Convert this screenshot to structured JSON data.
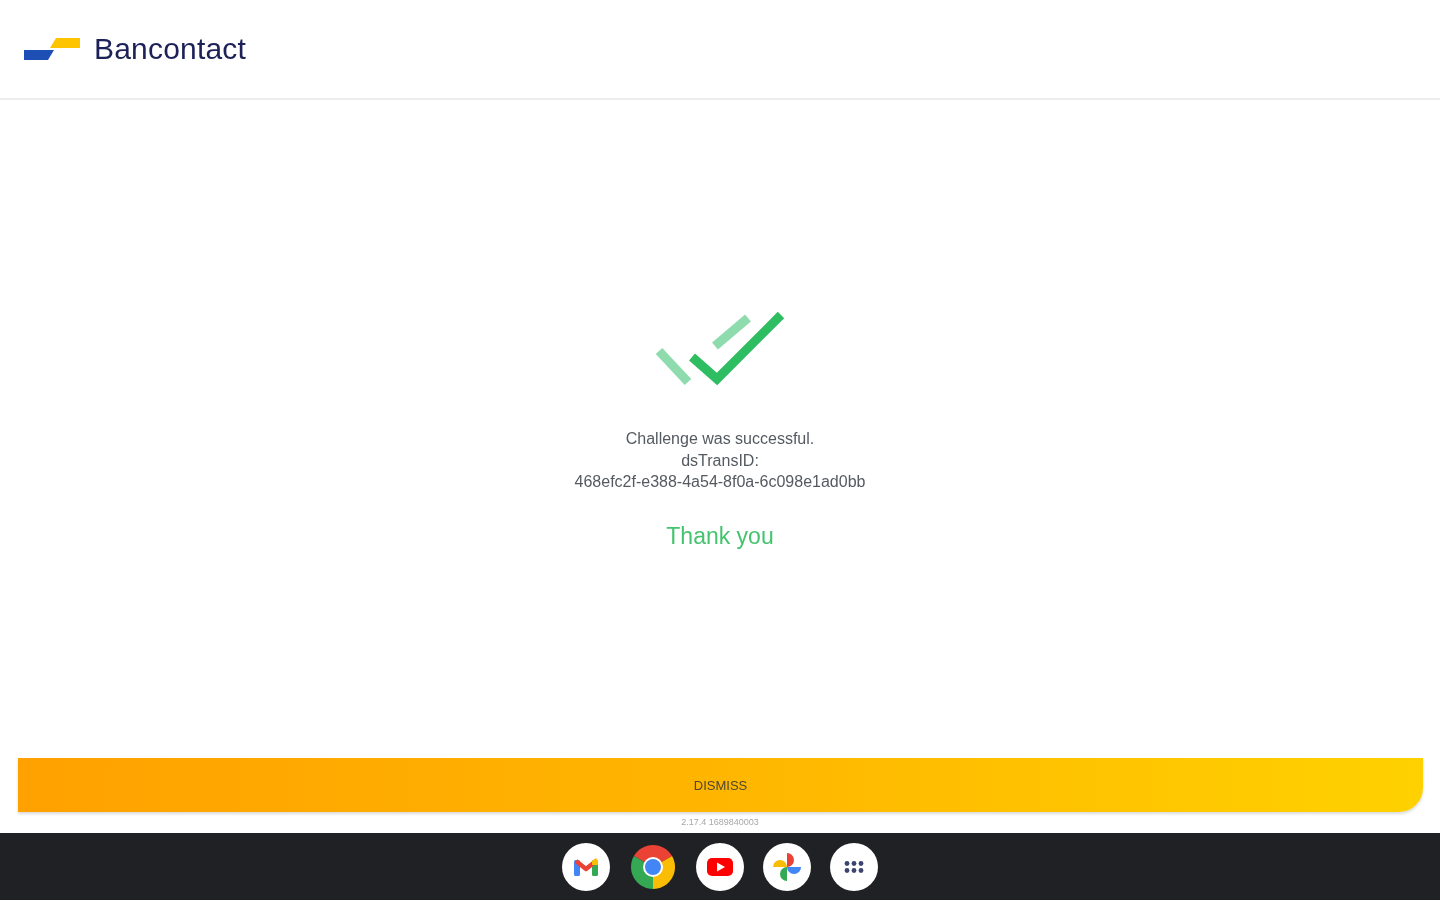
{
  "header": {
    "brand": "Bancontact"
  },
  "result": {
    "status": "Challenge was successful.",
    "id_label": "dsTransID:",
    "id_value": "468efc2f-e388-4a54-8f0a-6c098e1ad0bb",
    "thank_you": "Thank you"
  },
  "dismiss_button": {
    "label": "DISMISS"
  },
  "version": "2.17.4 1689840003",
  "shelf": {
    "apps": [
      {
        "kind": "mail"
      },
      {
        "kind": "browser"
      },
      {
        "kind": "video"
      },
      {
        "kind": "photos"
      },
      {
        "kind": "launcher"
      }
    ]
  }
}
